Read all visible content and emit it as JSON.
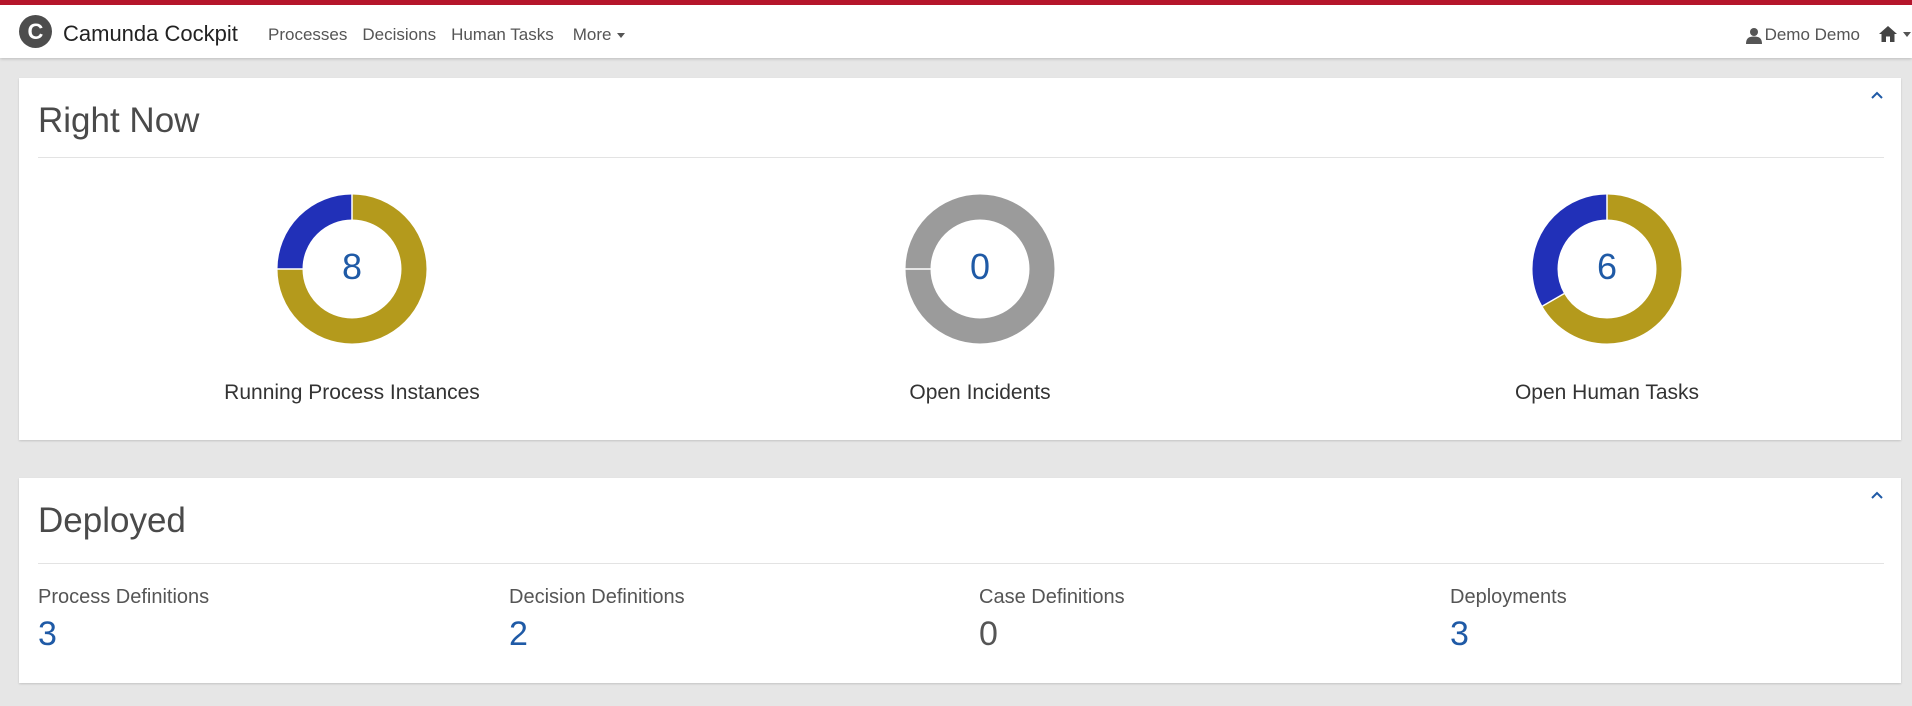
{
  "header": {
    "logo_letter": "C",
    "app_name": "Camunda Cockpit",
    "nav": [
      "Processes",
      "Decisions",
      "Human Tasks"
    ],
    "more_label": "More",
    "user_name": "Demo Demo",
    "brand_color": "#b5152b",
    "icons": {
      "user": "user-icon",
      "home": "home-icon"
    }
  },
  "right_now": {
    "title": "Right Now",
    "stats": [
      {
        "label": "Running Process Instances",
        "value": "8",
        "segments": [
          {
            "fraction": 0.25,
            "color": "#2130b8"
          },
          {
            "fraction": 0.75,
            "color": "#b49a1c"
          }
        ]
      },
      {
        "label": "Open Incidents",
        "value": "0",
        "segments": [
          {
            "fraction": 1.0,
            "color": "#9b9b9b"
          }
        ]
      },
      {
        "label": "Open Human Tasks",
        "value": "6",
        "segments": [
          {
            "fraction": 0.333,
            "color": "#2130b8"
          },
          {
            "fraction": 0.667,
            "color": "#b49a1c"
          }
        ]
      }
    ]
  },
  "deployed": {
    "title": "Deployed",
    "items": [
      {
        "label": "Process Definitions",
        "value": "3"
      },
      {
        "label": "Decision Definitions",
        "value": "2"
      },
      {
        "label": "Case Definitions",
        "value": "0"
      },
      {
        "label": "Deployments",
        "value": "3"
      }
    ]
  }
}
